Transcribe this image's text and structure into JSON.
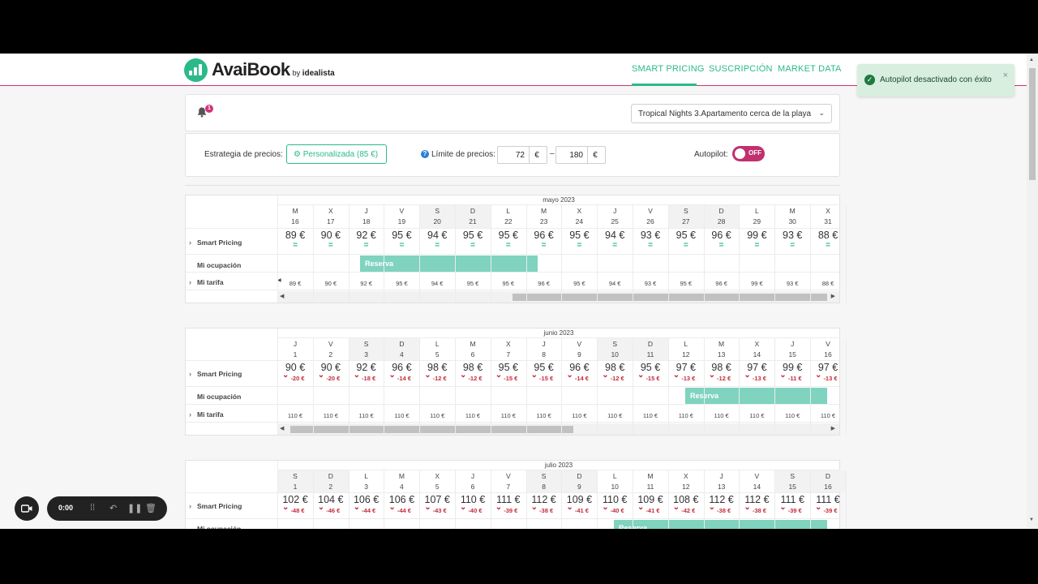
{
  "brand": {
    "name": "AvaiBook",
    "by": "by",
    "partner": "idealista"
  },
  "nav": {
    "smart_pricing": "SMART PRICING",
    "suscripcion": "SUSCRIPCIÓN",
    "market_data": "MARKET DATA"
  },
  "toast": {
    "message": "Autopilot desactivado con éxito",
    "close": "×"
  },
  "notifications": {
    "count": "1"
  },
  "property": {
    "selected": "Tropical Nights 3.Apartamento cerca de la playa"
  },
  "controls": {
    "strategy_label": "Estrategia de precios:",
    "strategy_value": "Personalizada (85 €)",
    "limit_label": "Límite de precios:",
    "min": "72",
    "max": "180",
    "currency": "€",
    "dash": "–",
    "autopilot_label": "Autopilot:",
    "autopilot_state": "OFF"
  },
  "row_labels": {
    "smart": "Smart Pricing",
    "occ": "Mi ocupación",
    "tarifa": "Mi tarifa",
    "reserva": "Reserva"
  },
  "calendars": [
    {
      "month": "mayo 2023",
      "days": [
        {
          "l": "M",
          "n": "16",
          "p": "89 €",
          "d": "=",
          "t": "89 €"
        },
        {
          "l": "X",
          "n": "17",
          "p": "90 €",
          "d": "=",
          "t": "90 €"
        },
        {
          "l": "J",
          "n": "18",
          "p": "92 €",
          "d": "=",
          "t": "92 €"
        },
        {
          "l": "V",
          "n": "19",
          "p": "95 €",
          "d": "=",
          "t": "95 €"
        },
        {
          "l": "S",
          "n": "20",
          "p": "94 €",
          "d": "=",
          "t": "94 €",
          "we": true
        },
        {
          "l": "D",
          "n": "21",
          "p": "95 €",
          "d": "=",
          "t": "95 €",
          "we": true
        },
        {
          "l": "L",
          "n": "22",
          "p": "95 €",
          "d": "=",
          "t": "95 €"
        },
        {
          "l": "M",
          "n": "23",
          "p": "96 €",
          "d": "=",
          "t": "96 €"
        },
        {
          "l": "X",
          "n": "24",
          "p": "95 €",
          "d": "=",
          "t": "95 €"
        },
        {
          "l": "J",
          "n": "25",
          "p": "94 €",
          "d": "=",
          "t": "94 €"
        },
        {
          "l": "V",
          "n": "26",
          "p": "93 €",
          "d": "=",
          "t": "93 €"
        },
        {
          "l": "S",
          "n": "27",
          "p": "95 €",
          "d": "=",
          "t": "95 €",
          "we": true
        },
        {
          "l": "D",
          "n": "28",
          "p": "96 €",
          "d": "=",
          "t": "96 €",
          "we": true
        },
        {
          "l": "L",
          "n": "29",
          "p": "99 €",
          "d": "=",
          "t": "99 €"
        },
        {
          "l": "M",
          "n": "30",
          "p": "93 €",
          "d": "=",
          "t": "93 €"
        },
        {
          "l": "X",
          "n": "31",
          "p": "88 €",
          "d": "=",
          "t": "88 €"
        }
      ]
    },
    {
      "month": "junio 2023",
      "days": [
        {
          "l": "J",
          "n": "1",
          "p": "90 €",
          "d": "-20 €",
          "t": "110 €"
        },
        {
          "l": "V",
          "n": "2",
          "p": "90 €",
          "d": "-20 €",
          "t": "110 €"
        },
        {
          "l": "S",
          "n": "3",
          "p": "92 €",
          "d": "-18 €",
          "t": "110 €",
          "we": true
        },
        {
          "l": "D",
          "n": "4",
          "p": "96 €",
          "d": "-14 €",
          "t": "110 €",
          "we": true
        },
        {
          "l": "L",
          "n": "5",
          "p": "98 €",
          "d": "-12 €",
          "t": "110 €"
        },
        {
          "l": "M",
          "n": "6",
          "p": "98 €",
          "d": "-12 €",
          "t": "110 €"
        },
        {
          "l": "X",
          "n": "7",
          "p": "95 €",
          "d": "-15 €",
          "t": "110 €"
        },
        {
          "l": "J",
          "n": "8",
          "p": "95 €",
          "d": "-15 €",
          "t": "110 €"
        },
        {
          "l": "V",
          "n": "9",
          "p": "96 €",
          "d": "-14 €",
          "t": "110 €"
        },
        {
          "l": "S",
          "n": "10",
          "p": "98 €",
          "d": "-12 €",
          "t": "110 €",
          "we": true
        },
        {
          "l": "D",
          "n": "11",
          "p": "95 €",
          "d": "-15 €",
          "t": "110 €",
          "we": true
        },
        {
          "l": "L",
          "n": "12",
          "p": "97 €",
          "d": "-13 €",
          "t": "110 €"
        },
        {
          "l": "M",
          "n": "13",
          "p": "98 €",
          "d": "-12 €",
          "t": "110 €"
        },
        {
          "l": "X",
          "n": "14",
          "p": "97 €",
          "d": "-13 €",
          "t": "110 €"
        },
        {
          "l": "J",
          "n": "15",
          "p": "99 €",
          "d": "-11 €",
          "t": "110 €"
        },
        {
          "l": "V",
          "n": "16",
          "p": "97 €",
          "d": "-13 €",
          "t": "110 €"
        }
      ]
    },
    {
      "month": "julio 2023",
      "days": [
        {
          "l": "S",
          "n": "1",
          "p": "102 €",
          "d": "-48 €",
          "we": true
        },
        {
          "l": "D",
          "n": "2",
          "p": "104 €",
          "d": "-46 €",
          "we": true
        },
        {
          "l": "L",
          "n": "3",
          "p": "106 €",
          "d": "-44 €"
        },
        {
          "l": "M",
          "n": "4",
          "p": "106 €",
          "d": "-44 €"
        },
        {
          "l": "X",
          "n": "5",
          "p": "107 €",
          "d": "-43 €"
        },
        {
          "l": "J",
          "n": "6",
          "p": "110 €",
          "d": "-40 €"
        },
        {
          "l": "V",
          "n": "7",
          "p": "111 €",
          "d": "-39 €"
        },
        {
          "l": "S",
          "n": "8",
          "p": "112 €",
          "d": "-38 €",
          "we": true
        },
        {
          "l": "D",
          "n": "9",
          "p": "109 €",
          "d": "-41 €",
          "we": true
        },
        {
          "l": "L",
          "n": "10",
          "p": "110 €",
          "d": "-40 €"
        },
        {
          "l": "M",
          "n": "11",
          "p": "109 €",
          "d": "-41 €"
        },
        {
          "l": "X",
          "n": "12",
          "p": "108 €",
          "d": "-42 €"
        },
        {
          "l": "J",
          "n": "13",
          "p": "112 €",
          "d": "-38 €"
        },
        {
          "l": "V",
          "n": "14",
          "p": "112 €",
          "d": "-38 €"
        },
        {
          "l": "S",
          "n": "15",
          "p": "111 €",
          "d": "-39 €",
          "we": true
        },
        {
          "l": "D",
          "n": "16",
          "p": "111 €",
          "d": "-39 €",
          "we": true
        }
      ]
    }
  ],
  "recorder": {
    "time": "0:00"
  },
  "colors": {
    "brand_green": "#2bb98a",
    "accent_pink": "#d1337a",
    "reserva": "#7fd3bf",
    "decrease_red": "#c42b3b"
  }
}
